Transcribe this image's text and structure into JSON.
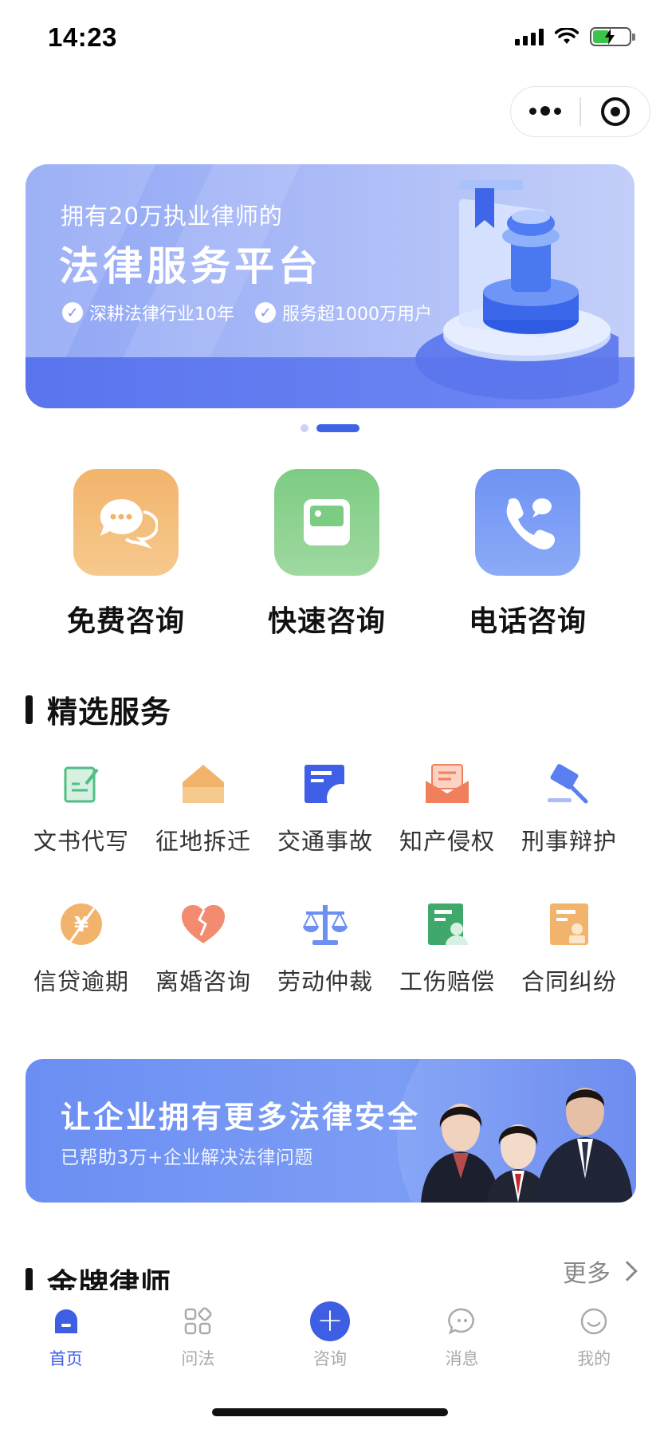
{
  "status_bar": {
    "time": "14:23"
  },
  "capsule": {
    "more_icon": "more-dots-icon",
    "close_icon": "target-icon"
  },
  "banner": {
    "subtitle": "拥有20万执业律师的",
    "title": "法律服务平台",
    "tags": [
      "深耕法律行业10年",
      "服务超1000万用户"
    ],
    "page_count": 2,
    "active_page": 2
  },
  "quick_actions": [
    {
      "label": "免费咨询",
      "icon": "chat-bubbles-icon",
      "color": "#f2b46c"
    },
    {
      "label": "快速咨询",
      "icon": "photo-card-icon",
      "color": "#7dcc83"
    },
    {
      "label": "电话咨询",
      "icon": "phone-icon",
      "color": "#6f93f4"
    }
  ],
  "selected_services": {
    "title": "精选服务",
    "items": [
      {
        "label": "文书代写",
        "icon": "document-edit-icon"
      },
      {
        "label": "征地拆迁",
        "icon": "house-icon"
      },
      {
        "label": "交通事故",
        "icon": "traffic-card-icon"
      },
      {
        "label": "知产侵权",
        "icon": "mail-envelope-icon"
      },
      {
        "label": "刑事辩护",
        "icon": "gavel-icon"
      },
      {
        "label": "信贷逾期",
        "icon": "yuan-coin-icon"
      },
      {
        "label": "离婚咨询",
        "icon": "broken-heart-icon"
      },
      {
        "label": "劳动仲裁",
        "icon": "scales-icon"
      },
      {
        "label": "工伤赔偿",
        "icon": "injury-file-icon"
      },
      {
        "label": "合同纠纷",
        "icon": "contract-icon"
      }
    ]
  },
  "enterprise_banner": {
    "title": "让企业拥有更多法律安全",
    "subtitle": "已帮助3万+企业解决法律问题"
  },
  "gold_lawyers": {
    "title": "金牌律师",
    "more": "更多"
  },
  "tabbar": {
    "items": [
      {
        "label": "首页",
        "icon": "home-icon",
        "active": true
      },
      {
        "label": "问法",
        "icon": "grid-icon",
        "active": false
      },
      {
        "label": "咨询",
        "icon": "plus-circle-icon",
        "active": false
      },
      {
        "label": "消息",
        "icon": "message-icon",
        "active": false
      },
      {
        "label": "我的",
        "icon": "smile-icon",
        "active": false
      }
    ]
  },
  "colors": {
    "accent": "#3e5fe3",
    "banner_blue": "#7b93f2"
  }
}
